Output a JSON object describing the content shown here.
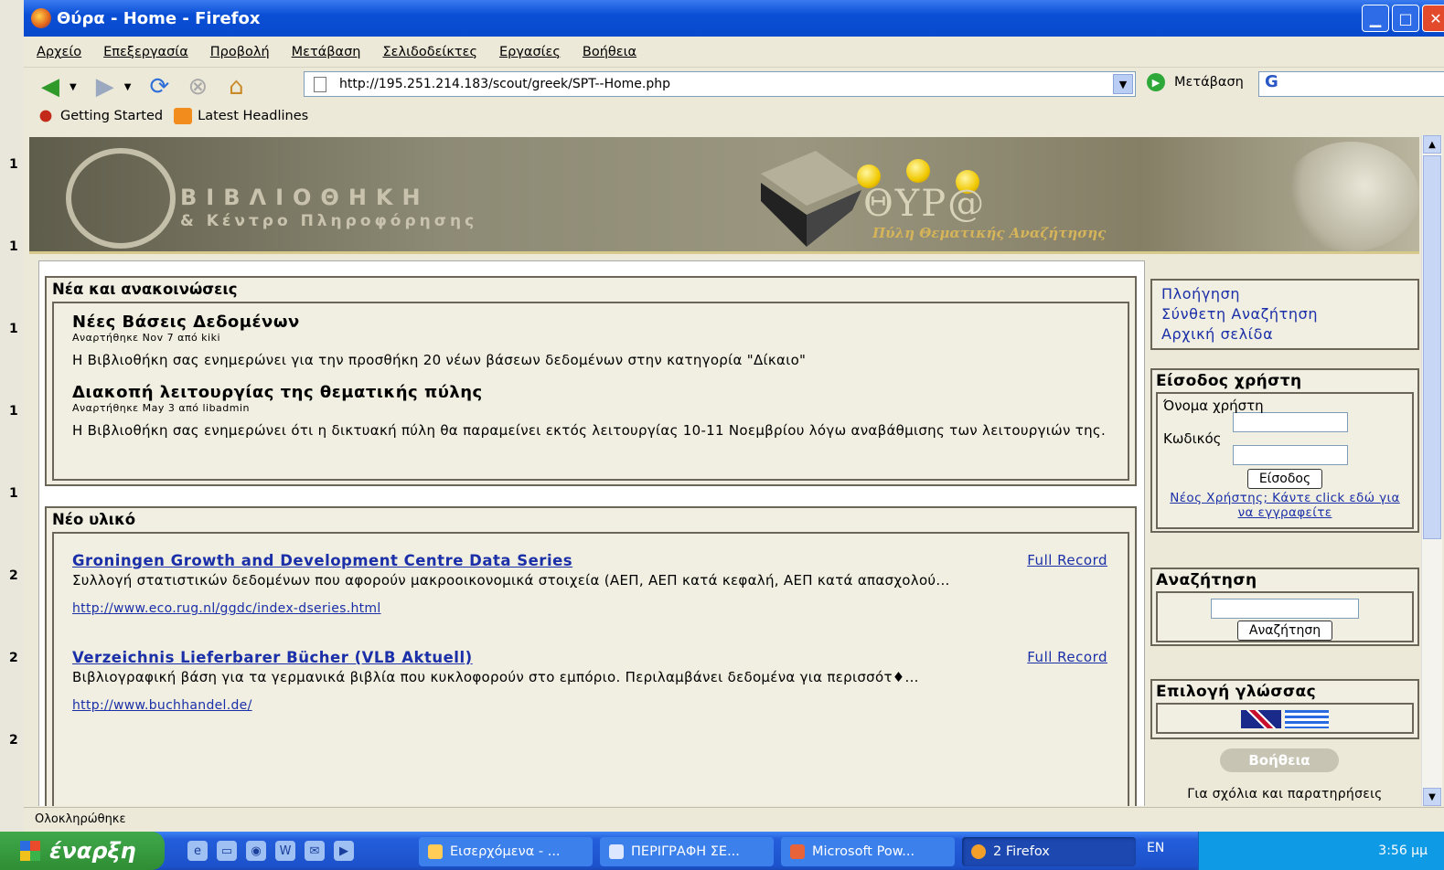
{
  "window": {
    "title": "Θύρα - Home - Firefox"
  },
  "menu": [
    "Αρχείο",
    "Επεξεργασία",
    "Προβολή",
    "Μετάβαση",
    "Σελιδοδείκτες",
    "Εργασίες",
    "Βοήθεια"
  ],
  "address": {
    "url": "http://195.251.214.183/scout/greek/SPT--Home.php",
    "go_label": "Μετάβαση"
  },
  "bookmarks": [
    "Getting Started",
    "Latest Headlines"
  ],
  "banner": {
    "lib_line1": "ΒΙΒΛΙΟΘΗΚΗ",
    "lib_line2": "& Κέντρο Πληροφόρησης",
    "portal_name": "ΘΥΡ@",
    "portal_sub": "Πύλη Θεματικής Αναζήτησης"
  },
  "news": {
    "heading": "Νέα και ανακοινώσεις",
    "items": [
      {
        "title": "Νέες Βάσεις Δεδομένων",
        "meta": "Αναρτήθηκε Nov 7 από kiki",
        "text": "Η Βιβλιοθήκη σας ενημερώνει για την προσθήκη 20 νέων βάσεων δεδομένων στην κατηγορία \"Δίκαιο\""
      },
      {
        "title": "Διακοπή λειτουργίας της θεματικής πύλης",
        "meta": "Αναρτήθηκε May 3 από libadmin",
        "text": "Η Βιβλιοθήκη σας ενημερώνει ότι η δικτυακή πύλη θα παραμείνει εκτός λειτουργίας 10-11 Νοεμβρίου λόγω αναβάθμισης των λειτουργιών της."
      }
    ]
  },
  "new_material": {
    "heading": "Νέο υλικό",
    "full_record": "Full Record",
    "items": [
      {
        "title": "Groningen Growth and Development Centre Data Series",
        "desc": "Συλλογή στατιστικών δεδομένων που αφορούν μακροοικονομικά στοιχεία (ΑΕΠ, ΑΕΠ κατά κεφαλή, ΑΕΠ κατά απασχολού...",
        "url": "http://www.eco.rug.nl/ggdc/index-dseries.html"
      },
      {
        "title": "Verzeichnis Lieferbarer Bücher (VLB Aktuell)",
        "desc": "Βιβλιογραφική βάση για τα γερμανικά βιβλία που κυκλοφορούν στο εμπόριο. Περιλαμβάνει δεδομένα για περισσότ♦...",
        "url": "http://www.buchhandel.de/"
      }
    ]
  },
  "sidebar": {
    "nav": [
      "Πλοήγηση",
      "Σύνθετη Αναζήτηση",
      "Αρχική σελίδα"
    ],
    "login": {
      "heading": "Είσοδος χρήστη",
      "user_label": "Όνομα χρήστη",
      "pass_label": "Κωδικός",
      "button": "Είσοδος",
      "register": "Νέος Χρήστης; Κάντε click εδώ για να εγγραφείτε"
    },
    "search": {
      "heading": "Αναζήτηση",
      "button": "Αναζήτηση"
    },
    "language": {
      "heading": "Επιλογή γλώσσας"
    },
    "help": {
      "label": "Βοήθεια",
      "comments": "Για σχόλια και παρατηρήσεις"
    }
  },
  "status": {
    "text": "Ολοκληρώθηκε"
  },
  "taskbar": {
    "start": "έναρξη",
    "tasks": [
      "Εισερχόμενα - ...",
      "ΠΕΡΙΓΡΑΦΗ ΣΕ...",
      "Microsoft Pow...",
      "2 Firefox"
    ],
    "lang": "EN",
    "time": "3:56 μμ"
  },
  "ppt_numbers": [
    "1",
    "1",
    "1",
    "1",
    "1",
    "2",
    "2",
    "2"
  ]
}
